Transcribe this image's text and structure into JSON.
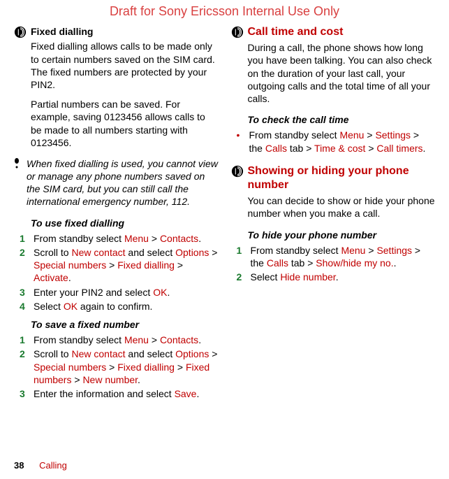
{
  "draft_banner": "Draft for Sony Ericsson Internal Use Only",
  "left": {
    "fixed_dialling": {
      "title": "Fixed dialling",
      "p1": "Fixed dialling allows calls to be made only to certain numbers saved on the SIM card. The fixed numbers are protected by your PIN2.",
      "p2": "Partial numbers can be saved. For example, saving 0123456 allows calls to be made to all numbers starting with 0123456.",
      "note": "When fixed dialling is used, you cannot view or manage any phone numbers saved on the SIM card, but you can still call the international emergency number, 112."
    },
    "to_use": {
      "title": "To use fixed dialling",
      "s1_pre": "From standby select ",
      "s1_menu": "Menu",
      "s1_gt": " > ",
      "s1_contacts": "Contacts",
      "s1_post": ".",
      "s2_pre": "Scroll to ",
      "s2_newcontact": "New contact",
      "s2_mid": " and select ",
      "s2_options": "Options",
      "s2_special": "Special numbers",
      "s2_fixed": "Fixed dialling",
      "s2_activate": "Activate",
      "s3_pre": "Enter your PIN2 and select ",
      "s3_ok": "OK",
      "s4_pre": "Select ",
      "s4_ok": "OK",
      "s4_post": " again to confirm."
    },
    "to_save": {
      "title": "To save a fixed number",
      "s1_pre": "From standby select ",
      "s1_menu": "Menu",
      "s1_contacts": "Contacts",
      "s2_pre": "Scroll to ",
      "s2_newcontact": "New contact",
      "s2_mid": " and select ",
      "s2_options": "Options",
      "s2_special": "Special numbers",
      "s2_fixed": "Fixed dialling",
      "s2_fixednums": "Fixed numbers",
      "s2_newnum": "New number",
      "s3_pre": "Enter the information and select ",
      "s3_save": "Save"
    }
  },
  "right": {
    "call_time": {
      "title": "Call time and cost",
      "p1": "During a call, the phone shows how long you have been talking. You can also check on the duration of your last call, your outgoing calls and the total time of all your calls.",
      "sub": "To check the call time",
      "b1_pre": "From standby select ",
      "b1_menu": "Menu",
      "b1_settings": "Settings",
      "b1_mid": " > the ",
      "b1_calls": "Calls",
      "b1_tab": " tab > ",
      "b1_time": "Time & cost",
      "b1_timers": "Call timers"
    },
    "show_hide": {
      "title": "Showing or hiding your phone number",
      "p1": "You can decide to show or hide your phone number when you make a call.",
      "sub": "To hide your phone number",
      "s1_pre": "From standby select ",
      "s1_menu": "Menu",
      "s1_settings": "Settings",
      "s1_mid": " > the ",
      "s1_calls": "Calls",
      "s1_tab": " tab > ",
      "s1_show": "Show/hide my no.",
      "s2_pre": "Select ",
      "s2_hide": "Hide number"
    }
  },
  "footer": {
    "page": "38",
    "section": "Calling"
  },
  "gt": " > ",
  "period": "."
}
